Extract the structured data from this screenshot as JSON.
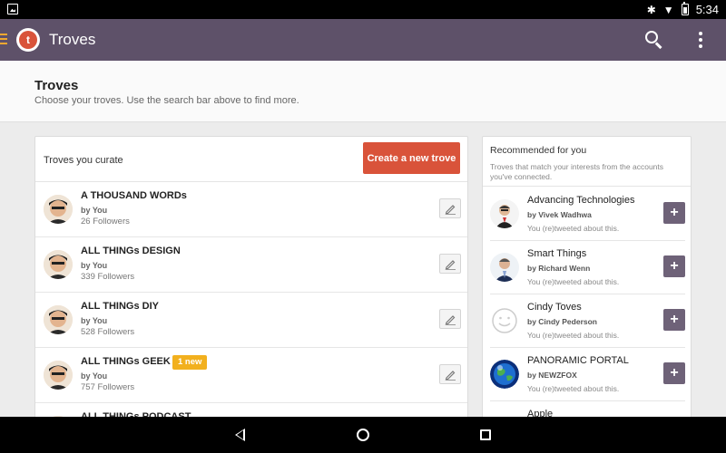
{
  "status_bar": {
    "time": "5:34"
  },
  "app_bar": {
    "logo_letter": "t",
    "title": "Troves"
  },
  "page_header": {
    "title": "Troves",
    "subtitle": "Choose your troves. Use the search bar above to find more."
  },
  "curate": {
    "label": "Troves you curate",
    "create_label": "Create a new trove",
    "troves": [
      {
        "name": "A THOUSAND WORDs",
        "by": "by You",
        "followers": "26 Followers",
        "badge": ""
      },
      {
        "name": "ALL THINGs DESIGN",
        "by": "by You",
        "followers": "339 Followers",
        "badge": ""
      },
      {
        "name": "ALL THINGs DIY",
        "by": "by You",
        "followers": "528 Followers",
        "badge": ""
      },
      {
        "name": "ALL THINGs GEEK",
        "by": "by You",
        "followers": "757 Followers",
        "badge": "1 new"
      },
      {
        "name": "ALL THINGs PODCAST",
        "by": "",
        "followers": "",
        "badge": ""
      }
    ]
  },
  "recommended": {
    "title": "Recommended for you",
    "subtitle": "Troves that match your interests from the accounts you've connected.",
    "items": [
      {
        "name": "Advancing Technologies",
        "by": "by Vivek Wadhwa",
        "reason": "You (re)tweeted about this.",
        "add_label": "+"
      },
      {
        "name": "Smart Things",
        "by": "by Richard Wenn",
        "reason": "You (re)tweeted about this.",
        "add_label": "+"
      },
      {
        "name": "Cindy Toves",
        "by": "by Cindy Pederson",
        "reason": "You (re)tweeted about this.",
        "add_label": "+"
      },
      {
        "name": "PANORAMIC PORTAL",
        "by": "by NEWZFOX",
        "reason": "You (re)tweeted about this.",
        "add_label": "+"
      },
      {
        "name": "Apple",
        "by": "",
        "reason": "",
        "add_label": ""
      }
    ]
  },
  "colors": {
    "app_bar": "#5e5169",
    "accent": "#d9533a",
    "badge": "#f2b01e",
    "add_button": "#6e6278"
  }
}
